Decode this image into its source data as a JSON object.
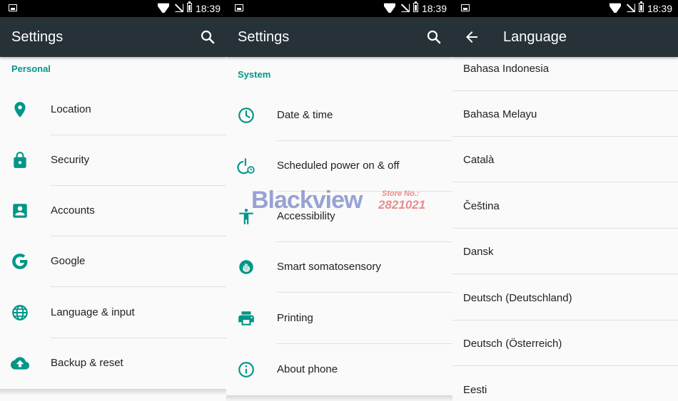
{
  "status_bar": {
    "time": "18:39"
  },
  "panel_settings_personal": {
    "title": "Settings",
    "section": "Personal",
    "items": [
      {
        "label": "Location",
        "icon": "location-pin-icon"
      },
      {
        "label": "Security",
        "icon": "lock-icon"
      },
      {
        "label": "Accounts",
        "icon": "account-box-icon"
      },
      {
        "label": "Google",
        "icon": "google-icon"
      },
      {
        "label": "Language & input",
        "icon": "globe-icon"
      },
      {
        "label": "Backup & reset",
        "icon": "cloud-upload-icon"
      }
    ]
  },
  "panel_settings_system": {
    "title": "Settings",
    "section": "System",
    "items": [
      {
        "label": "Date & time",
        "icon": "clock-icon"
      },
      {
        "label": "Scheduled power on & off",
        "icon": "power-clock-icon"
      },
      {
        "label": "Accessibility",
        "icon": "accessibility-icon"
      },
      {
        "label": "Smart somatosensory",
        "icon": "hand-gesture-icon"
      },
      {
        "label": "Printing",
        "icon": "printer-icon"
      },
      {
        "label": "About phone",
        "icon": "info-icon"
      }
    ]
  },
  "panel_language": {
    "title": "Language",
    "items": [
      "Bahasa Indonesia",
      "Bahasa Melayu",
      "Català",
      "Čeština",
      "Dansk",
      "Deutsch (Deutschland)",
      "Deutsch (Österreich)",
      "Eesti"
    ]
  },
  "watermark": {
    "brand": "Blackview",
    "store_label": "Store No.:",
    "store_number": "2821021"
  },
  "colors": {
    "accent": "#009688",
    "app_bar": "#263238",
    "background": "#fafafa",
    "divider": "#e0e0e0"
  }
}
